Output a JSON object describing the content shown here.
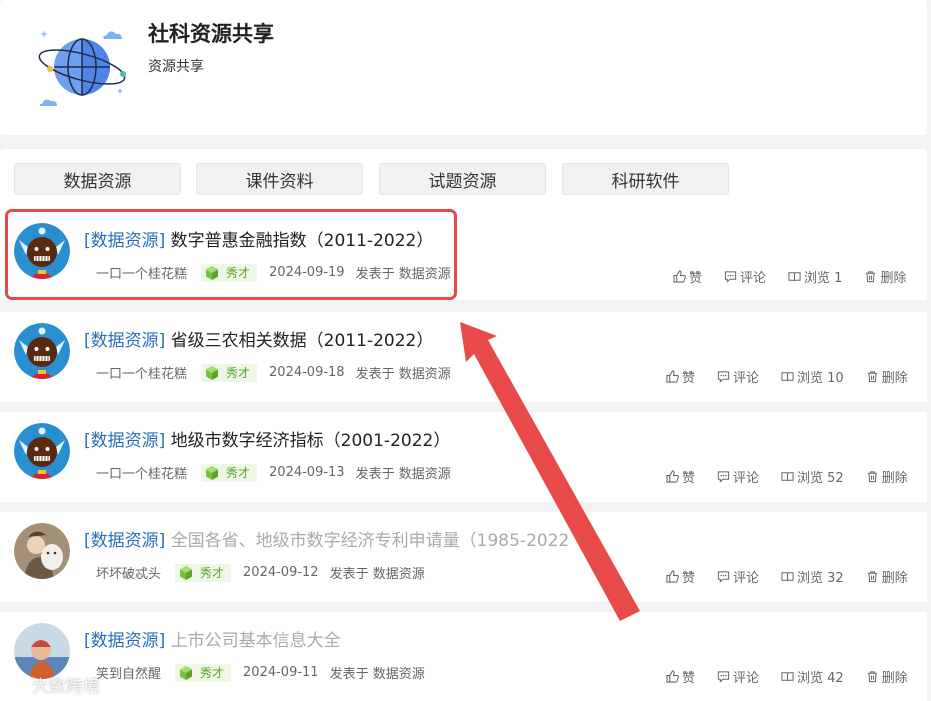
{
  "group": {
    "title": "社科资源共享",
    "subtitle": "资源共享"
  },
  "tabs": [
    "数据资源",
    "课件资料",
    "试题资源",
    "科研软件"
  ],
  "posts": [
    {
      "category": "[数据资源]",
      "title": "数字普惠金融指数（2011-2022）",
      "author": "一口一个桂花糕",
      "badge": "秀才",
      "date": "2024-09-19",
      "posted_in": "发表于 数据资源",
      "like": "赞",
      "comment": "评论",
      "views": "浏览 1",
      "delete": "删除",
      "avatar": "robot-avatar",
      "title_color": "dark"
    },
    {
      "category": "[数据资源]",
      "title": "省级三农相关数据（2011-2022）",
      "author": "一口一个桂花糕",
      "badge": "秀才",
      "date": "2024-09-18",
      "posted_in": "发表于 数据资源",
      "like": "赞",
      "comment": "评论",
      "views": "浏览 10",
      "delete": "删除",
      "avatar": "robot-avatar",
      "title_color": "dark"
    },
    {
      "category": "[数据资源]",
      "title": "地级市数字经济指标（2001-2022）",
      "author": "一口一个桂花糕",
      "badge": "秀才",
      "date": "2024-09-13",
      "posted_in": "发表于 数据资源",
      "like": "赞",
      "comment": "评论",
      "views": "浏览 52",
      "delete": "删除",
      "avatar": "robot-avatar",
      "title_color": "dark"
    },
    {
      "category": "[数据资源]",
      "title": "全国各省、地级市数字经济专利申请量（1985-2022",
      "author": "坏坏破忒头",
      "badge": "秀才",
      "date": "2024-09-12",
      "posted_in": "发表于 数据资源",
      "like": "赞",
      "comment": "评论",
      "views": "浏览 32",
      "delete": "删除",
      "avatar": "photo-avatar",
      "title_color": "gray"
    },
    {
      "category": "[数据资源]",
      "title": "上市公司基本信息大全",
      "author": "笑到自然醒",
      "badge": "秀才",
      "date": "2024-09-11",
      "posted_in": "发表于 数据资源",
      "like": "赞",
      "comment": "评论",
      "views": "浏览 42",
      "delete": "删除",
      "avatar": "photo-avatar",
      "title_color": "gray"
    }
  ],
  "watermark": "大数跨境",
  "colors": {
    "category": "#2a6fb8",
    "highlight": "#e84a4a",
    "arrow": "#e84a4a",
    "badge_bg": "#eef7e6",
    "badge_text": "#5aa42a"
  }
}
